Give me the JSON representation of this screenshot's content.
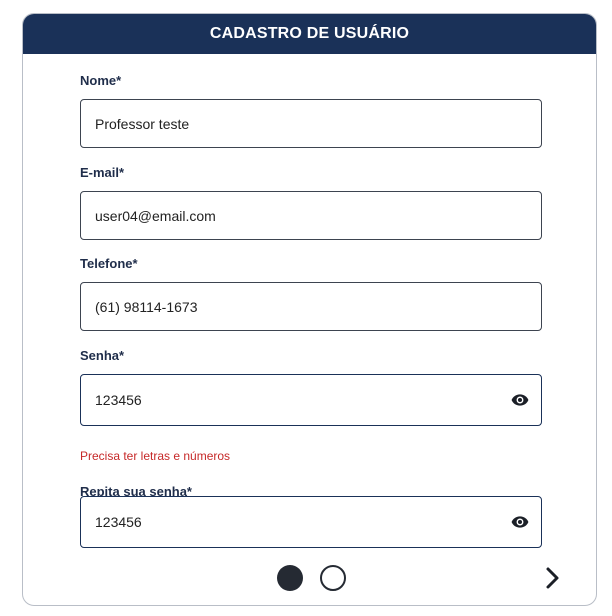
{
  "header": {
    "title": "CADASTRO DE USUÁRIO"
  },
  "form": {
    "name": {
      "label": "Nome*",
      "value": "Professor teste"
    },
    "email": {
      "label": "E-mail*",
      "value": "user04@email.com"
    },
    "phone": {
      "label": "Telefone*",
      "value": "(61) 98114-1673"
    },
    "password": {
      "label": "Senha*",
      "value": "123456",
      "icon": "eye-icon",
      "error": "Precisa ter letras e números"
    },
    "confirm_password": {
      "label": "Repita sua senha*",
      "value": "123456",
      "icon": "eye-icon"
    }
  },
  "pagination": {
    "current_step": 1,
    "total_steps": 2,
    "next_icon": "chevron-right-icon"
  },
  "colors": {
    "header_bg": "#1a3158",
    "error": "#c62828",
    "dot": "#252a33"
  }
}
